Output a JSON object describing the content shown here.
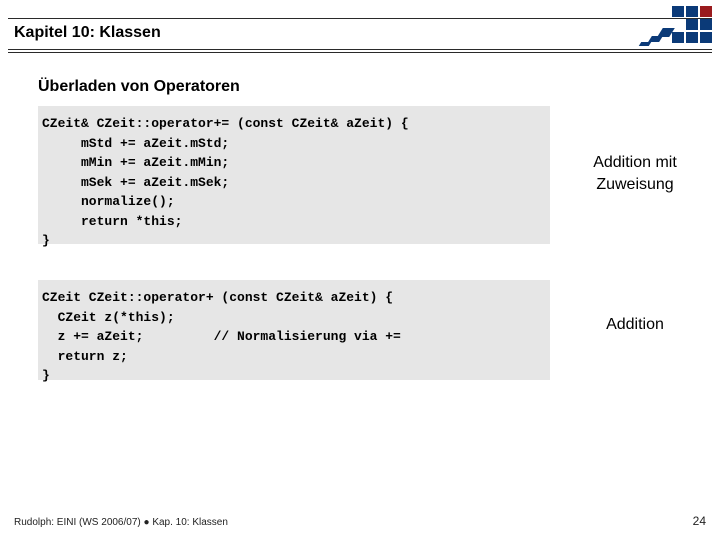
{
  "header": {
    "chapter": "Kapitel 10: Klassen"
  },
  "section": {
    "title": "Überladen von Operatoren"
  },
  "code1": "CZeit& CZeit::operator+= (const CZeit& aZeit) {\n     mStd += aZeit.mStd;\n     mMin += aZeit.mMin;\n     mSek += aZeit.mSek;\n     normalize();\n     return *this;\n}",
  "caption1_line1": "Addition mit",
  "caption1_line2": "Zuweisung",
  "code2": "CZeit CZeit::operator+ (const CZeit& aZeit) {\n  CZeit z(*this);\n  z += aZeit;         // Normalisierung via +=\n  return z;\n}",
  "caption2": "Addition",
  "footer": {
    "text": "Rudolph: EINI (WS 2006/07) ● Kap. 10: Klassen",
    "page": "24"
  }
}
